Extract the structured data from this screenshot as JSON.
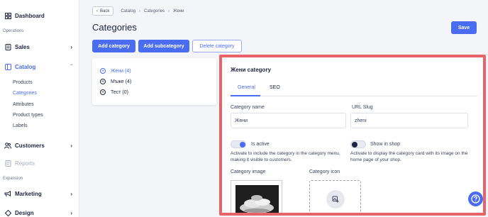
{
  "sidebar": {
    "dashboard": "Dashboard",
    "section_operations": "Operations",
    "sales": "Sales",
    "catalog": "Catalog",
    "catalog_items": [
      "Products",
      "Categories",
      "Attributes",
      "Product types",
      "Labels"
    ],
    "customers": "Customers",
    "reports": "Reports",
    "section_expansion": "Expansion",
    "marketing": "Marketing",
    "design": "Design"
  },
  "breadcrumb": {
    "back": "Back",
    "items": [
      "Catalog",
      "Categories",
      "Жени"
    ]
  },
  "page": {
    "title": "Categories",
    "save": "Save"
  },
  "actions": {
    "add_category": "Add category",
    "add_subcategory": "Add subcategory",
    "delete_category": "Delete category"
  },
  "tree": {
    "items": [
      "Жени (4)",
      "Мъже (4)",
      "Тест (0)"
    ]
  },
  "detail": {
    "title": "Жени category",
    "tabs": [
      "General",
      "SEO"
    ],
    "category_name_label": "Category name",
    "category_name_value": "Жени",
    "url_slug_label": "URL Slug",
    "url_slug_value": "zheni",
    "is_active_label": "Is active",
    "is_active_help": "Activate to include the category in the category menu, making it visible to customers.",
    "show_in_shop_label": "Show in shop",
    "show_in_shop_help": "Activate to display the category card with its image on the home page of your shop.",
    "category_image_label": "Category image",
    "category_icon_label": "Category icon"
  },
  "colors": {
    "accent": "#4a6cf0",
    "highlight": "#e8626a"
  }
}
